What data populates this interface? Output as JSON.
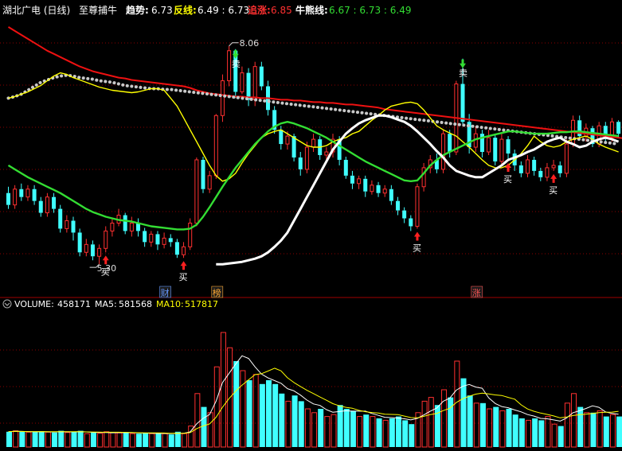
{
  "header": {
    "stock": "湖北广电 (日线)",
    "indicator": "至尊捕牛",
    "items": [
      {
        "label": "趋势:",
        "value": "6.73",
        "label_color": "#ffffff",
        "value_color": "#ffffff"
      },
      {
        "label": "反线:",
        "value": "6.49 : 6.73",
        "label_color": "#ffff00",
        "value_color": "#ffffff"
      },
      {
        "label": "追涨:",
        "value": "6.85",
        "label_color": "#ff3030",
        "value_color": "#ff3030"
      },
      {
        "label": "牛熊线:",
        "value": "6.67 : 6.73 : 6.49",
        "label_color": "#ffffff",
        "value_color": "#33dd33"
      }
    ]
  },
  "volume_header": {
    "items": [
      {
        "label": "VOLUME:",
        "value": "458171",
        "color": "#ffffff"
      },
      {
        "label": "MA5:",
        "value": "581568",
        "color": "#ffffff"
      },
      {
        "label": "MA10:",
        "value": "517817",
        "color": "#ffff00"
      }
    ]
  },
  "colors": {
    "up": "#ff3030",
    "down": "#40ffff",
    "trend": "#ffffff",
    "fan": "#ffff00",
    "chase": "#ee1111",
    "bullbear": "#33dd33",
    "dots": "#c8c8c8",
    "grid": "#8b0000"
  },
  "chart_data": {
    "type": "candlestick",
    "price_range": [
      5.0,
      8.4
    ],
    "volume_range": [
      0,
      700000
    ],
    "annotations": {
      "high_label": "8.06",
      "low_label": "5.30",
      "buy_label": "买",
      "sell_label": "卖",
      "event_labels": [
        "财",
        "榜",
        "涨"
      ]
    },
    "candles": [
      [
        6.2,
        6.05,
        6.28,
        6.0,
        80000
      ],
      [
        6.05,
        6.25,
        6.3,
        6.0,
        85000
      ],
      [
        6.25,
        6.15,
        6.32,
        6.1,
        80000
      ],
      [
        6.15,
        6.25,
        6.3,
        6.1,
        78000
      ],
      [
        6.25,
        6.1,
        6.3,
        6.05,
        80000
      ],
      [
        6.1,
        5.95,
        6.15,
        5.9,
        82000
      ],
      [
        5.95,
        6.15,
        6.2,
        5.9,
        78000
      ],
      [
        6.15,
        6.0,
        6.2,
        5.95,
        76000
      ],
      [
        6.0,
        5.75,
        6.05,
        5.7,
        85000
      ],
      [
        5.75,
        5.85,
        5.92,
        5.7,
        76000
      ],
      [
        5.85,
        5.7,
        5.9,
        5.6,
        80000
      ],
      [
        5.7,
        5.45,
        5.75,
        5.4,
        85000
      ],
      [
        5.45,
        5.55,
        5.62,
        5.4,
        70000
      ],
      [
        5.55,
        5.4,
        5.6,
        5.35,
        75000
      ],
      [
        5.4,
        5.5,
        5.55,
        5.3,
        72000
      ],
      [
        5.5,
        5.72,
        5.78,
        5.45,
        80000
      ],
      [
        5.72,
        5.82,
        5.88,
        5.65,
        76000
      ],
      [
        5.82,
        5.92,
        6.0,
        5.78,
        74000
      ],
      [
        5.92,
        5.72,
        5.95,
        5.68,
        78000
      ],
      [
        5.72,
        5.82,
        5.9,
        5.65,
        70000
      ],
      [
        5.82,
        5.72,
        5.88,
        5.65,
        70000
      ],
      [
        5.72,
        5.58,
        5.76,
        5.52,
        75000
      ],
      [
        5.58,
        5.68,
        5.72,
        5.52,
        70000
      ],
      [
        5.68,
        5.55,
        5.72,
        5.48,
        72000
      ],
      [
        5.55,
        5.63,
        5.7,
        5.5,
        70000
      ],
      [
        5.63,
        5.58,
        5.68,
        5.52,
        66000
      ],
      [
        5.58,
        5.42,
        5.62,
        5.38,
        80000
      ],
      [
        5.42,
        5.52,
        5.58,
        5.38,
        70000
      ],
      [
        5.52,
        5.82,
        5.88,
        5.48,
        110000
      ],
      [
        5.82,
        6.62,
        6.65,
        5.78,
        280000
      ],
      [
        6.62,
        6.25,
        6.66,
        6.2,
        210000
      ],
      [
        6.25,
        6.42,
        6.48,
        6.2,
        180000
      ],
      [
        6.42,
        7.18,
        7.2,
        6.38,
        420000
      ],
      [
        7.18,
        7.62,
        7.7,
        7.1,
        600000
      ],
      [
        7.62,
        8.0,
        8.06,
        7.55,
        520000
      ],
      [
        8.0,
        7.48,
        8.02,
        7.4,
        450000
      ],
      [
        7.48,
        7.72,
        7.8,
        7.45,
        400000
      ],
      [
        7.72,
        7.38,
        7.78,
        7.3,
        350000
      ],
      [
        7.38,
        7.8,
        7.86,
        7.3,
        380000
      ],
      [
        7.8,
        7.55,
        7.86,
        7.5,
        330000
      ],
      [
        7.55,
        7.25,
        7.62,
        7.18,
        350000
      ],
      [
        7.25,
        7.0,
        7.3,
        6.95,
        330000
      ],
      [
        7.0,
        6.82,
        7.05,
        6.75,
        280000
      ],
      [
        6.82,
        6.92,
        6.98,
        6.75,
        240000
      ],
      [
        6.92,
        6.65,
        6.95,
        6.6,
        270000
      ],
      [
        6.65,
        6.5,
        6.72,
        6.42,
        240000
      ],
      [
        6.5,
        6.78,
        6.85,
        6.45,
        200000
      ],
      [
        6.78,
        6.88,
        6.95,
        6.72,
        180000
      ],
      [
        6.88,
        6.68,
        6.92,
        6.62,
        200000
      ],
      [
        6.68,
        6.72,
        6.78,
        6.62,
        160000
      ],
      [
        6.72,
        6.88,
        6.95,
        6.65,
        170000
      ],
      [
        6.88,
        6.62,
        6.92,
        6.55,
        220000
      ],
      [
        6.62,
        6.42,
        6.66,
        6.38,
        200000
      ],
      [
        6.42,
        6.32,
        6.48,
        6.25,
        190000
      ],
      [
        6.32,
        6.38,
        6.42,
        6.25,
        160000
      ],
      [
        6.38,
        6.22,
        6.42,
        6.15,
        170000
      ],
      [
        6.22,
        6.3,
        6.36,
        6.18,
        160000
      ],
      [
        6.3,
        6.2,
        6.34,
        6.15,
        150000
      ],
      [
        6.2,
        6.25,
        6.3,
        6.15,
        140000
      ],
      [
        6.25,
        6.1,
        6.3,
        6.05,
        150000
      ],
      [
        6.1,
        5.98,
        6.15,
        5.92,
        160000
      ],
      [
        5.98,
        5.88,
        6.02,
        5.82,
        140000
      ],
      [
        5.88,
        5.78,
        5.92,
        5.72,
        120000
      ],
      [
        5.78,
        6.28,
        6.32,
        5.75,
        180000
      ],
      [
        6.28,
        6.52,
        6.58,
        6.22,
        240000
      ],
      [
        6.52,
        6.62,
        6.68,
        6.45,
        260000
      ],
      [
        6.62,
        6.5,
        6.7,
        6.45,
        220000
      ],
      [
        6.5,
        6.95,
        7.0,
        6.45,
        300000
      ],
      [
        6.95,
        6.72,
        7.0,
        6.65,
        260000
      ],
      [
        6.72,
        7.58,
        7.62,
        6.68,
        450000
      ],
      [
        7.58,
        7.1,
        7.9,
        7.05,
        360000
      ],
      [
        7.1,
        6.78,
        7.2,
        6.7,
        270000
      ],
      [
        6.78,
        6.95,
        7.05,
        6.72,
        230000
      ],
      [
        6.95,
        6.72,
        7.0,
        6.65,
        230000
      ],
      [
        6.72,
        6.9,
        7.0,
        6.68,
        200000
      ],
      [
        6.9,
        6.6,
        6.95,
        6.55,
        210000
      ],
      [
        6.6,
        6.88,
        6.95,
        6.55,
        190000
      ],
      [
        6.88,
        6.7,
        6.92,
        6.62,
        200000
      ],
      [
        6.7,
        6.55,
        6.75,
        6.48,
        170000
      ],
      [
        6.55,
        6.45,
        6.6,
        6.4,
        150000
      ],
      [
        6.45,
        6.62,
        6.68,
        6.4,
        140000
      ],
      [
        6.62,
        6.48,
        6.66,
        6.42,
        150000
      ],
      [
        6.48,
        6.4,
        6.52,
        6.35,
        140000
      ],
      [
        6.4,
        6.52,
        6.58,
        6.35,
        160000
      ],
      [
        6.52,
        6.55,
        6.62,
        6.48,
        120000
      ],
      [
        6.55,
        6.45,
        6.6,
        6.4,
        110000
      ],
      [
        6.45,
        6.82,
        6.88,
        6.4,
        230000
      ],
      [
        6.82,
        7.12,
        7.18,
        6.78,
        280000
      ],
      [
        7.12,
        6.92,
        7.18,
        6.88,
        210000
      ],
      [
        6.92,
        7.02,
        7.08,
        6.85,
        180000
      ],
      [
        7.02,
        6.82,
        7.05,
        6.78,
        180000
      ],
      [
        6.82,
        7.05,
        7.1,
        6.78,
        190000
      ],
      [
        7.05,
        6.9,
        7.1,
        6.85,
        160000
      ],
      [
        6.9,
        7.1,
        7.15,
        6.85,
        170000
      ],
      [
        7.1,
        6.95,
        7.12,
        6.9,
        160000
      ]
    ],
    "trend": [
      5.3,
      5.3,
      5.31,
      5.32,
      5.33,
      5.35,
      5.37,
      5.4,
      5.45,
      5.52,
      5.6,
      5.7,
      5.85,
      6.0,
      6.15,
      6.3,
      6.45,
      6.6,
      6.75,
      6.85,
      6.95,
      7.02,
      7.08,
      7.12,
      7.15,
      7.18,
      7.18,
      7.16,
      7.13,
      7.1,
      7.05,
      6.98,
      6.9,
      6.82,
      6.73,
      6.65,
      6.55,
      6.48,
      6.45,
      6.42,
      6.4,
      6.4,
      6.45,
      6.5,
      6.55,
      6.62,
      6.65,
      6.68,
      6.72,
      6.75,
      6.8,
      6.85,
      6.88,
      6.9,
      6.85,
      6.82,
      6.78,
      6.8,
      6.85,
      6.88,
      6.9,
      6.88,
      6.85
    ],
    "trend_start": 32,
    "fan": [
      7.4,
      7.42,
      7.45,
      7.48,
      7.52,
      7.56,
      7.62,
      7.68,
      7.72,
      7.7,
      7.66,
      7.63,
      7.6,
      7.57,
      7.54,
      7.52,
      7.5,
      7.49,
      7.48,
      7.47,
      7.48,
      7.5,
      7.52,
      7.52,
      7.5,
      7.4,
      7.3,
      7.15,
      7.0,
      6.85,
      6.7,
      6.55,
      6.42,
      6.35,
      6.38,
      6.45,
      6.58,
      6.7,
      6.8,
      6.9,
      6.95,
      6.98,
      7.0,
      6.95,
      6.9,
      6.85,
      6.8,
      6.78,
      6.78,
      6.8,
      6.85,
      6.88,
      6.9,
      6.95,
      6.98,
      7.05,
      7.12,
      7.18,
      7.25,
      7.3,
      7.32,
      7.34,
      7.35,
      7.33,
      7.25,
      7.15,
      7.05,
      7.0,
      6.96,
      6.92,
      6.85,
      6.78,
      6.7,
      6.62,
      6.55,
      6.52,
      6.52,
      6.55,
      6.62,
      6.7,
      6.8,
      6.92,
      6.85,
      6.8,
      6.78,
      6.8,
      6.85,
      6.88,
      6.9,
      6.92,
      6.88,
      6.82,
      6.78,
      6.75,
      6.72
    ],
    "chase": [
      8.3,
      8.25,
      8.2,
      8.15,
      8.1,
      8.05,
      8.0,
      7.96,
      7.92,
      7.88,
      7.84,
      7.8,
      7.77,
      7.74,
      7.72,
      7.7,
      7.68,
      7.66,
      7.65,
      7.63,
      7.62,
      7.61,
      7.6,
      7.59,
      7.58,
      7.57,
      7.56,
      7.55,
      7.53,
      7.5,
      7.48,
      7.46,
      7.45,
      7.44,
      7.43,
      7.42,
      7.42,
      7.41,
      7.41,
      7.4,
      7.4,
      7.39,
      7.38,
      7.38,
      7.37,
      7.37,
      7.36,
      7.35,
      7.35,
      7.34,
      7.34,
      7.33,
      7.32,
      7.32,
      7.31,
      7.3,
      7.29,
      7.28,
      7.26,
      7.25,
      7.24,
      7.23,
      7.22,
      7.21,
      7.2,
      7.19,
      7.18,
      7.17,
      7.16,
      7.15,
      7.14,
      7.13,
      7.12,
      7.11,
      7.1,
      7.09,
      7.08,
      7.07,
      7.06,
      7.05,
      7.04,
      7.03,
      7.02,
      7.01,
      7.0,
      6.99,
      6.98,
      6.97,
      6.96,
      6.95,
      6.94,
      6.93,
      6.92,
      6.91,
      6.9,
      6.89
    ],
    "bullbear": [
      7.4,
      7.42,
      7.45,
      7.5,
      7.55,
      7.6,
      7.63,
      7.66,
      7.68,
      7.69,
      7.68,
      7.66,
      7.65,
      7.64,
      7.62,
      7.61,
      7.6,
      7.58,
      7.56,
      7.55,
      7.54,
      7.53,
      7.52,
      7.52,
      7.51,
      7.51,
      7.5,
      7.49,
      7.48,
      7.47,
      7.46,
      7.45,
      7.44,
      7.43,
      7.42,
      7.41,
      7.4,
      7.39,
      7.38,
      7.37,
      7.36,
      7.35,
      7.34,
      7.33,
      7.32,
      7.31,
      7.3,
      7.29,
      7.28,
      7.27,
      7.26,
      7.25,
      7.24,
      7.23,
      7.22,
      7.21,
      7.2,
      7.19,
      7.18,
      7.17,
      7.16,
      7.15,
      7.14,
      7.13,
      7.12,
      7.11,
      7.1,
      7.09,
      7.08,
      7.07,
      7.06,
      7.05,
      7.04,
      7.03,
      7.02,
      7.01,
      7.0,
      6.99,
      6.98,
      6.97,
      6.96,
      6.95,
      6.94,
      6.93,
      6.92,
      6.91,
      6.9,
      6.89,
      6.88,
      6.87,
      6.86,
      6.85,
      6.84,
      6.83,
      6.82
    ],
    "lower_green": [
      6.55,
      6.5,
      6.45,
      6.4,
      6.36,
      6.32,
      6.28,
      6.24,
      6.2,
      6.15,
      6.1,
      6.05,
      6.0,
      5.96,
      5.93,
      5.9,
      5.88,
      5.86,
      5.85,
      5.84,
      5.82,
      5.8,
      5.78,
      5.77,
      5.76,
      5.75,
      5.74,
      5.74,
      5.75,
      5.8,
      5.9,
      6.02,
      6.15,
      6.28,
      6.4,
      6.52,
      6.62,
      6.72,
      6.82,
      6.9,
      6.98,
      7.04,
      7.08,
      7.1,
      7.08,
      7.05,
      7.02,
      6.98,
      6.94,
      6.9,
      6.85,
      6.8,
      6.75,
      6.7,
      6.65,
      6.6,
      6.56,
      6.52,
      6.48,
      6.44,
      6.4,
      6.36,
      6.35,
      6.36,
      6.45,
      6.55,
      6.62,
      6.68,
      6.72,
      6.76,
      6.8,
      6.84,
      6.88,
      6.9,
      6.92,
      6.94,
      6.96,
      6.98,
      6.98,
      6.97,
      6.96,
      6.95,
      6.95,
      6.95,
      6.96,
      6.97,
      6.97,
      6.98,
      6.98,
      6.97,
      6.96,
      6.95,
      6.94,
      6.93,
      6.92
    ],
    "buy_signals": [
      {
        "i": 15,
        "at": "low"
      },
      {
        "i": 27,
        "at": "low"
      },
      {
        "i": 63,
        "at": "low"
      },
      {
        "i": 77,
        "at": "low"
      },
      {
        "i": 84,
        "at": "low"
      }
    ],
    "sell_signals": [
      {
        "i": 35,
        "at": "high"
      },
      {
        "i": 70,
        "at": "high"
      }
    ],
    "events": [
      {
        "i": 24,
        "label": "财",
        "color": "#6699ff"
      },
      {
        "i": 32,
        "label": "榜",
        "color": "#ffaa33"
      },
      {
        "i": 72,
        "label": "涨",
        "color": "#ff5555"
      }
    ]
  }
}
